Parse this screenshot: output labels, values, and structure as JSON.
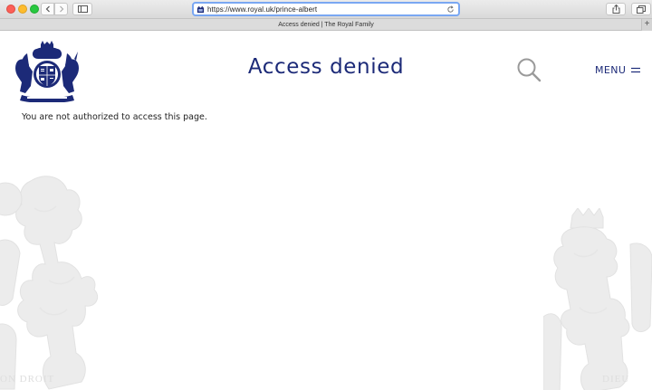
{
  "browser": {
    "url": "https://www.royal.uk/prince-albert",
    "tab_title": "Access denied | The Royal Family",
    "new_tab_label": "+"
  },
  "header": {
    "title": "Access denied",
    "menu_label": "MENU"
  },
  "main": {
    "message": "You are not authorized to access this page."
  },
  "watermark": {
    "left_motto": "ON DROIT",
    "right_motto": "DIEU"
  },
  "icons": {
    "crest": "royal-coat-of-arms-icon",
    "search": "search-icon",
    "menu": "hamburger-icon"
  },
  "colors": {
    "brand_blue": "#1c2a78",
    "address_focus": "#7aa7f2",
    "watermark": "#e6e6e6"
  }
}
